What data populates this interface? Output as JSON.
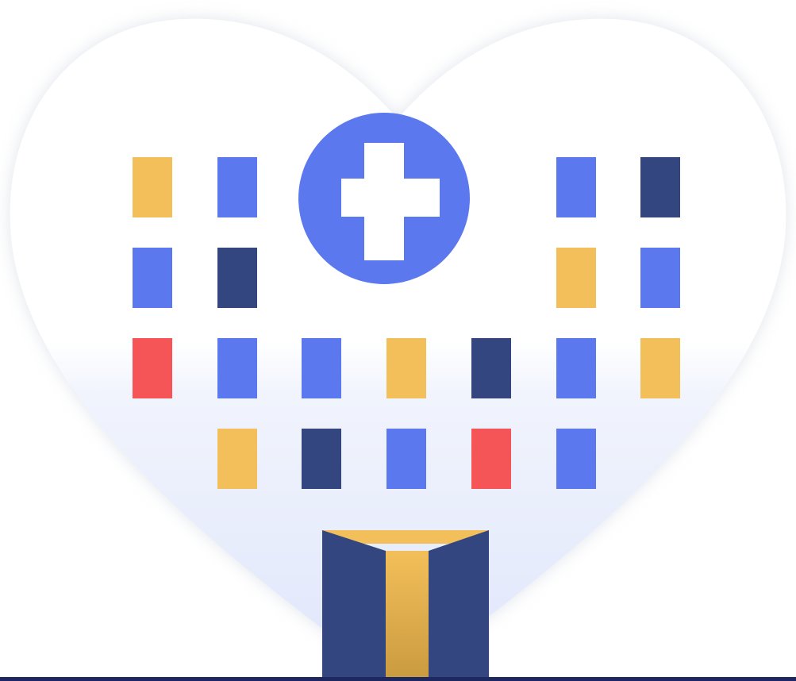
{
  "illustration": {
    "subject": "",
    "colors": {
      "background": "#ffffff",
      "heart_fill": "#ffffff",
      "heart_tint": "#dfe6fb",
      "shadow": "#c9cfdc",
      "cross_circle": "#5b78ee",
      "cross": "#ffffff",
      "blue": "#5b78ee",
      "navy": "#334680",
      "yellow": "#f3bf5a",
      "red": "#f65558",
      "door_navy": "#334680",
      "door_gold": "#f3bf5a",
      "bottom_bar": "#1d2760"
    },
    "windows": [
      [
        "yellow",
        "blue",
        "",
        "",
        "",
        "blue",
        "navy"
      ],
      [
        "blue",
        "navy",
        "",
        "",
        "",
        "yellow",
        "blue"
      ],
      [
        "red",
        "blue",
        "blue",
        "yellow",
        "navy",
        "blue",
        "yellow"
      ],
      [
        "",
        "yellow",
        "navy",
        "blue",
        "red",
        "blue",
        ""
      ]
    ],
    "icons": [
      "heart-icon",
      "medical-cross-icon",
      "hospital-building-icon",
      "door-icon"
    ]
  }
}
